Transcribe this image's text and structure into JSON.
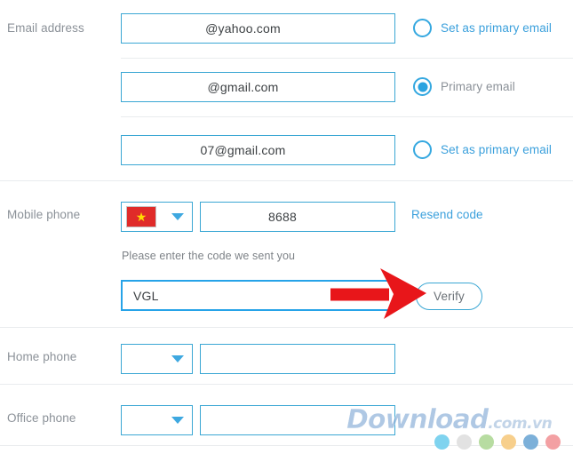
{
  "rows": {
    "email_label": "Email address",
    "mobile_label": "Mobile phone",
    "home_label": "Home phone",
    "office_label": "Office phone"
  },
  "emails": [
    {
      "value": "@yahoo.com",
      "radio_label": "Set as primary email",
      "selected": false
    },
    {
      "value": "@gmail.com",
      "radio_label": "Primary email",
      "selected": true
    },
    {
      "value": "07@gmail.com",
      "radio_label": "Set as primary email",
      "selected": false
    }
  ],
  "mobile": {
    "country_flag": "vietnam-flag",
    "flag_star": "★",
    "number": "8688",
    "resend_label": "Resend code",
    "hint": "Please enter the code we sent you",
    "code_value": "VGL",
    "verify_label": "Verify"
  },
  "home_phone": {
    "country_value": "",
    "number": ""
  },
  "office_phone": {
    "country_value": "",
    "number": ""
  },
  "annotation": {
    "arrow": "red-right-arrow"
  },
  "watermark": {
    "main": "Download",
    "tld": ".com.vn",
    "dots": [
      "#7fd3ef",
      "#e2e2e2",
      "#b7dca1",
      "#f7cf8c",
      "#7cb0d9",
      "#f3a0a3"
    ]
  },
  "colors": {
    "border_blue": "#3ba7d4",
    "focus_blue": "#26a3e8",
    "link_blue": "#3ba0dc",
    "label_gray": "#8b9198",
    "arrow_red": "#e8161a"
  }
}
